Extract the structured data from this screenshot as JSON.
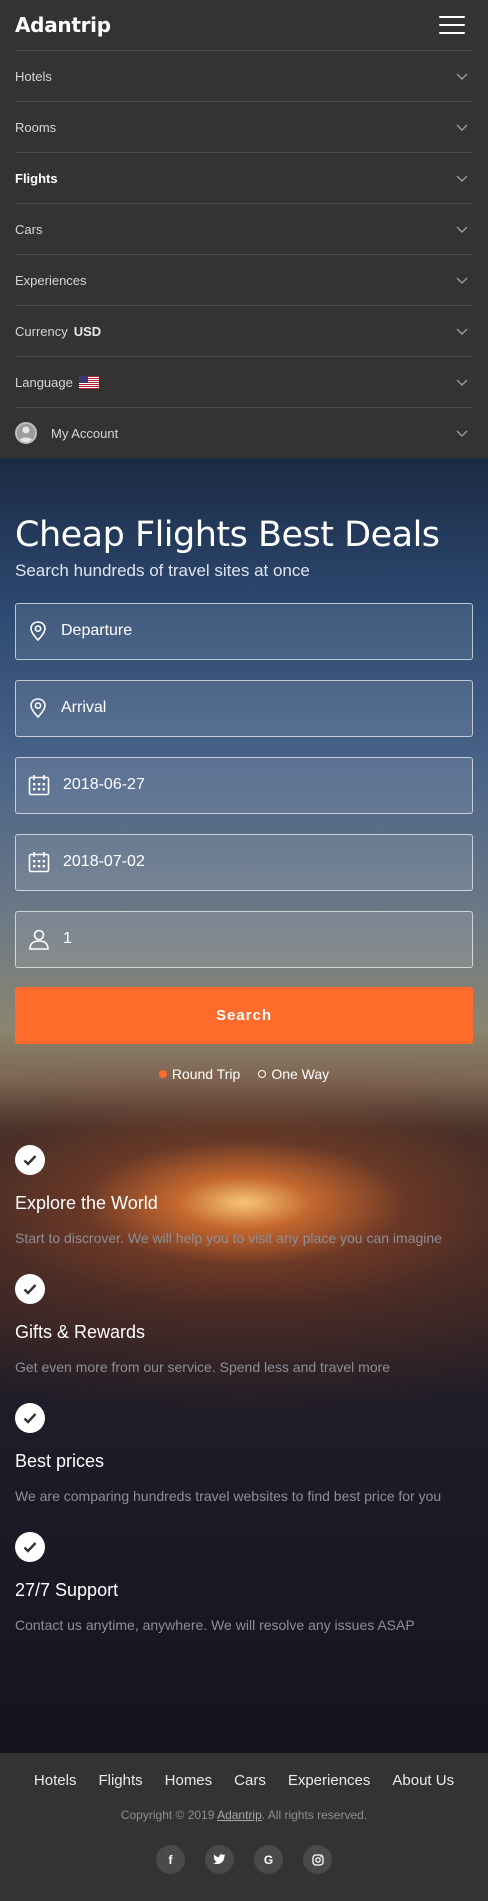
{
  "brand": {
    "logo": "Adantrip"
  },
  "nav": {
    "items": [
      {
        "label": "Hotels"
      },
      {
        "label": "Rooms"
      },
      {
        "label": "Flights"
      },
      {
        "label": "Cars"
      },
      {
        "label": "Experiences"
      }
    ],
    "currency": {
      "label": "Currency",
      "value": "USD"
    },
    "language": {
      "label": "Language",
      "flag": "us-flag-icon"
    },
    "account": {
      "label": "My Account"
    }
  },
  "hero": {
    "title": "Cheap Flights Best Deals",
    "subtitle": "Search hundreds of travel sites at once"
  },
  "form": {
    "departure": "Departure",
    "arrival": "Arrival",
    "depart_date": "2018-06-27",
    "return_date": "2018-07-02",
    "passengers": "1",
    "search_label": "Search",
    "trip_options": [
      {
        "label": "Round Trip",
        "selected": true
      },
      {
        "label": "One Way",
        "selected": false
      }
    ]
  },
  "features": [
    {
      "title": "Explore the World",
      "text": "Start to discrover. We will help you to visit any place you can imagine"
    },
    {
      "title": "Gifts & Rewards",
      "text": "Get even more from our service. Spend less and travel more"
    },
    {
      "title": "Best prices",
      "text": "We are comparing hundreds travel websites to find best price for you"
    },
    {
      "title": "27/7 Support",
      "text": "Contact us anytime, anywhere. We will resolve any issues ASAP"
    }
  ],
  "footer": {
    "links": [
      "Hotels",
      "Flights",
      "Homes",
      "Cars",
      "Experiences",
      "About Us"
    ],
    "copyright_prefix": "Copyright © 2019",
    "copyright_brand": "Adantrip",
    "copyright_suffix": ". All rights reserved.",
    "social": [
      {
        "icon": "facebook-icon",
        "glyph": "f"
      },
      {
        "icon": "twitter-icon",
        "glyph": "t"
      },
      {
        "icon": "google-icon",
        "glyph": "G"
      },
      {
        "icon": "instagram-icon",
        "glyph": "◎"
      }
    ]
  },
  "colors": {
    "accent": "#ff6b2b",
    "nav_bg": "#333333"
  }
}
